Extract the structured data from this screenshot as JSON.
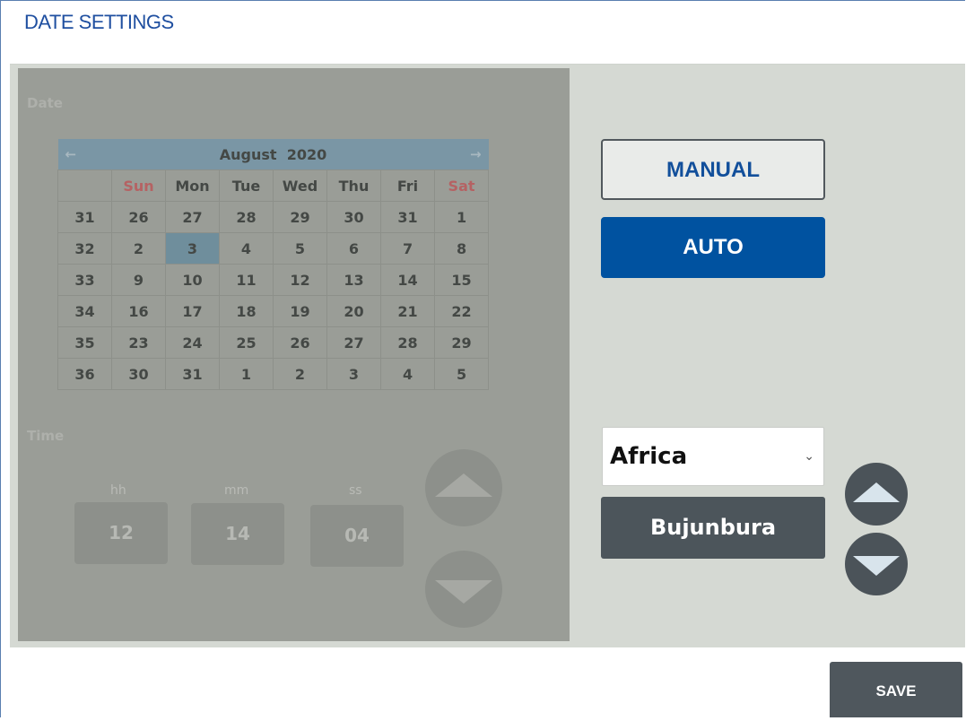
{
  "title": "DATE SETTINGS",
  "date_section": {
    "label": "Date",
    "calendar": {
      "month": "August",
      "year": "2020",
      "prev": "←",
      "next": "→",
      "weekdays": [
        "Sun",
        "Mon",
        "Tue",
        "Wed",
        "Thu",
        "Fri",
        "Sat"
      ],
      "weeks": [
        {
          "num": "31",
          "days": [
            "26",
            "27",
            "28",
            "29",
            "30",
            "31",
            "1"
          ]
        },
        {
          "num": "32",
          "days": [
            "2",
            "3",
            "4",
            "5",
            "6",
            "7",
            "8"
          ]
        },
        {
          "num": "33",
          "days": [
            "9",
            "10",
            "11",
            "12",
            "13",
            "14",
            "15"
          ]
        },
        {
          "num": "34",
          "days": [
            "16",
            "17",
            "18",
            "19",
            "20",
            "21",
            "22"
          ]
        },
        {
          "num": "35",
          "days": [
            "23",
            "24",
            "25",
            "26",
            "27",
            "28",
            "29"
          ]
        },
        {
          "num": "36",
          "days": [
            "30",
            "31",
            "1",
            "2",
            "3",
            "4",
            "5"
          ]
        }
      ],
      "selected_day": "3"
    }
  },
  "time_section": {
    "label": "Time",
    "hh_label": "hh",
    "hh": "12",
    "mm_label": "mm",
    "mm": "14",
    "ss_label": "ss",
    "ss": "04"
  },
  "mode": {
    "manual_label": "MANUAL",
    "auto_label": "AUTO",
    "selected": "AUTO"
  },
  "timezone": {
    "region": "Africa",
    "city": "Bujunbura"
  },
  "save_label": "SAVE",
  "colors": {
    "accent": "#0052a0",
    "title": "#1f4fa0",
    "dark_button": "#4c555b",
    "weekend": "#b56263"
  },
  "icons": {
    "up": "triangle-up",
    "down": "triangle-down",
    "dropdown": "chevron-down"
  }
}
